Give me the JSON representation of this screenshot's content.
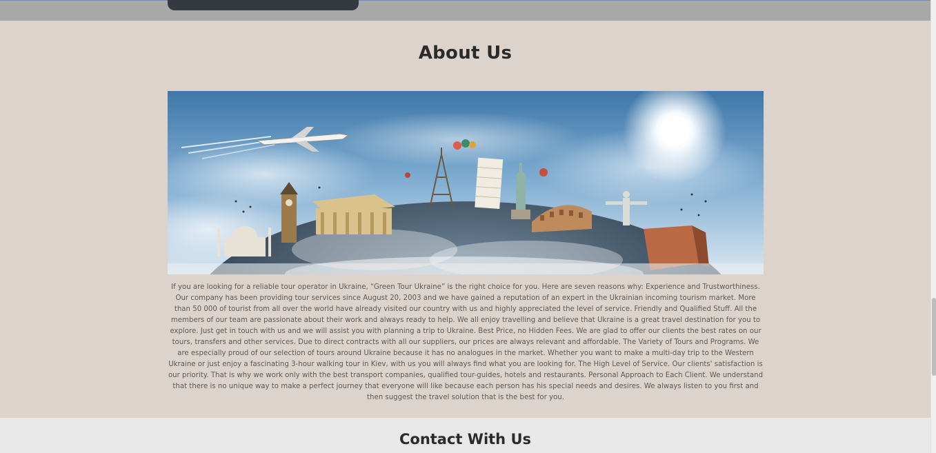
{
  "about": {
    "title": "About Us",
    "image_alt": "World landmarks on a globe with an airplane in the sky",
    "description": "If you are looking for a reliable tour operator in Ukraine, “Green Tour Ukraine” is the right choice for you. Here are seven reasons why: Experience and Trustworthiness. Our company has been providing tour services since August 20, 2003 and we have gained a reputation of an expert in the Ukrainian incoming tourism market. More than 50 000 of tourist from all over the world have already visited our country with us and highly appreciated the level of service. Friendly and Qualified Stuff. All the members of our team are passionate about their work and always ready to help. We all enjoy travelling and believe that Ukraine is a great travel destination for you to explore. Just get in touch with us and we will assist you with planning a trip to Ukraine. Best Price, no Hidden Fees. We are glad to offer our clients the best rates on our tours, transfers and other services. Due to direct contracts with all our suppliers, our prices are always relevant and affordable. The Variety of Tours and Programs. We are especially proud of our selection of tours around Ukraine because it has no analogues in the market. Whether you want to make a multi-day trip to the Western Ukraine or just enjoy a fascinating 3-hour walking tour in Kiev, with us you will always find what you are looking for. The High Level of Service. Our clients' satisfaction is our priority. That is why we work only with the best transport companies, qualified tour-guides, hotels and restaurants. Personal Approach to Each Client. We understand that there is no unique way to make a perfect journey that everyone will like because each person has his special needs and desires. We always listen to you first and then suggest the travel solution that is the best for you."
  },
  "contact": {
    "title": "Contact With Us"
  },
  "colors": {
    "about_bg": "#dcd3cc",
    "contact_bg": "#e8e8e8",
    "top_strip_bg": "#a8a8a8",
    "heading": "#2a2a2a",
    "body_text": "#5a5a5a"
  }
}
